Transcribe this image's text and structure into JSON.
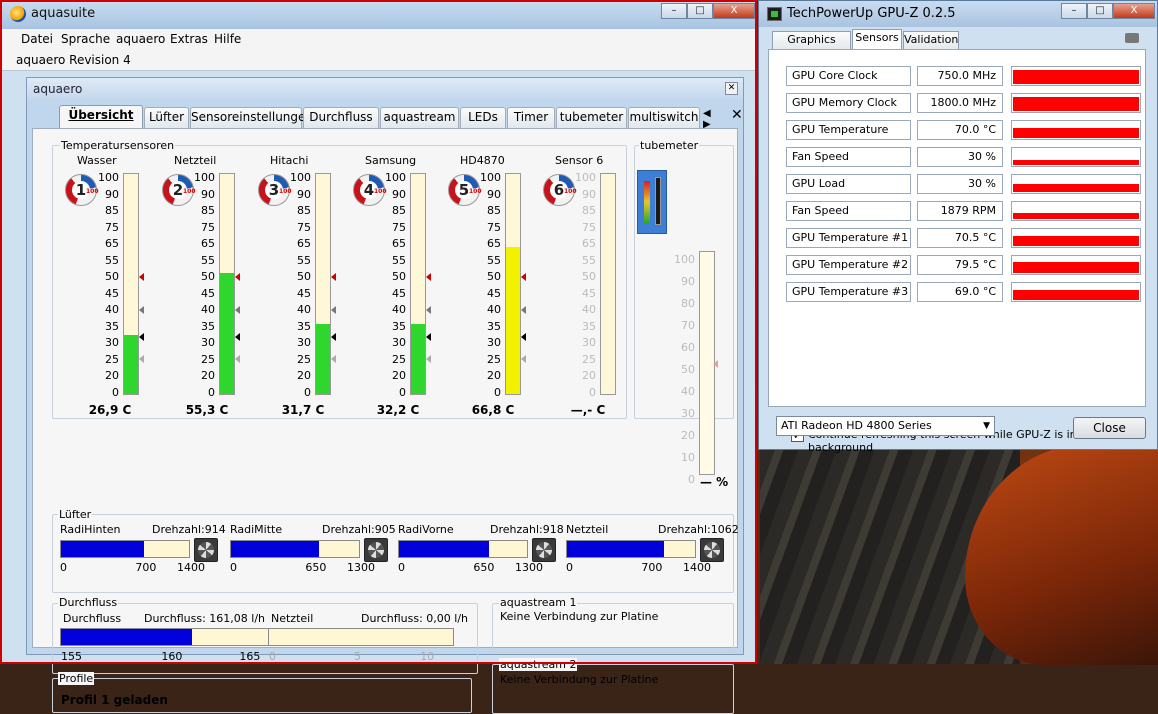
{
  "aquasuite": {
    "title": "aquasuite",
    "menu": [
      "Datei",
      "Sprache",
      "aquaero",
      "Extras",
      "Hilfe"
    ],
    "revision": "aquaero Revision 4",
    "window_controls": {
      "minimize": "–",
      "maximize": "□",
      "close": "X"
    },
    "inner_title": "aquaero",
    "tabs": [
      "Übersicht",
      "Lüfter",
      "Sensoreinstellungen",
      "Durchfluss",
      "aquastream",
      "LEDs",
      "Timer",
      "tubemeter",
      "multiswitch"
    ],
    "active_tab": "Übersicht",
    "tab_nav": "◀ ▶",
    "temperature_group": "Temperatursensoren",
    "scale_ticks": [
      "100",
      "90",
      "85",
      "75",
      "65",
      "55",
      "50",
      "45",
      "40",
      "35",
      "30",
      "25",
      "20",
      "0"
    ],
    "sensors": [
      {
        "name": "Wasser",
        "num": "1",
        "value": "26,9 C",
        "fill": 27,
        "color": "#2ed62e"
      },
      {
        "name": "Netzteil",
        "num": "2",
        "value": "55,3 C",
        "fill": 55,
        "color": "#2ed62e"
      },
      {
        "name": "Hitachi",
        "num": "3",
        "value": "31,7 C",
        "fill": 32,
        "color": "#2ed62e"
      },
      {
        "name": "Samsung",
        "num": "4",
        "value": "32,2 C",
        "fill": 32,
        "color": "#2ed62e"
      },
      {
        "name": "HD4870",
        "num": "5",
        "value": "66,8 C",
        "fill": 67,
        "color": "#f2f200"
      },
      {
        "name": "Sensor 6",
        "num": "6",
        "value": "—,- C",
        "fill": 0,
        "color": "#2ed62e"
      }
    ],
    "gauge_small": "100",
    "tubemeter": {
      "label": "tubemeter",
      "ticks": [
        "100",
        "90",
        "80",
        "70",
        "60",
        "50",
        "40",
        "30",
        "20",
        "10",
        "0"
      ],
      "value": "— %"
    },
    "fan_group": "Lüfter",
    "fans": [
      {
        "name": "RadiHinten",
        "rpm": "Drehzahl:914",
        "fill": 65,
        "ticks": [
          "0",
          "700",
          "1400"
        ]
      },
      {
        "name": "RadiMitte",
        "rpm": "Drehzahl:905",
        "fill": 69,
        "ticks": [
          "0",
          "650",
          "1300"
        ]
      },
      {
        "name": "RadiVorne",
        "rpm": "Drehzahl:918",
        "fill": 70,
        "ticks": [
          "0",
          "650",
          "1300"
        ]
      },
      {
        "name": "Netzteil",
        "rpm": "Drehzahl:1062",
        "fill": 76,
        "ticks": [
          "0",
          "700",
          "1400"
        ]
      }
    ],
    "flow_group": "Durchfluss",
    "flows": [
      {
        "name": "Durchfluss",
        "value": "Durchfluss: 161,08 l/h",
        "fill": 60,
        "ticks": [
          "155",
          "160",
          "165"
        ]
      },
      {
        "name": "Netzteil",
        "value": "Durchfluss: 0,00 l/h",
        "fill": 0,
        "ticks": [
          "0",
          "5",
          "10"
        ]
      }
    ],
    "aquastream1": {
      "title": "aquastream 1",
      "status": "Keine Verbindung zur Platine"
    },
    "aquastream2": {
      "title": "aquastream 2",
      "status": "Keine Verbindung zur Platine"
    },
    "profile": {
      "title": "Profile",
      "status": "Profil 1 geladen"
    }
  },
  "gpuz": {
    "title": "TechPowerUp GPU-Z 0.2.5",
    "tabs": [
      "Graphics Card",
      "Sensors",
      "Validation"
    ],
    "active_tab": "Sensors",
    "rows": [
      {
        "label": "GPU Core Clock",
        "value": "750.0 MHz",
        "level": 0.75
      },
      {
        "label": "GPU Memory Clock",
        "value": "1800.0 MHz",
        "level": 0.8
      },
      {
        "label": "GPU Temperature",
        "value": "70.0 °C",
        "level": 0.55
      },
      {
        "label": "Fan Speed",
        "value": "30 %",
        "level": 0.25
      },
      {
        "label": "GPU Load",
        "value": "30 %",
        "level": 0.45
      },
      {
        "label": "Fan Speed",
        "value": "1879 RPM",
        "level": 0.35
      },
      {
        "label": "GPU Temperature #1",
        "value": "70.5 °C",
        "level": 0.55
      },
      {
        "label": "GPU Temperature #2",
        "value": "79.5 °C",
        "level": 0.6
      },
      {
        "label": "GPU Temperature #3",
        "value": "69.0 °C",
        "level": 0.55
      }
    ],
    "checkbox_label": "Continue refreshing this screen while GPU-Z is in the background",
    "checkbox_mark": "✓",
    "device": "ATI Radeon HD 4800 Series",
    "close": "Close"
  }
}
